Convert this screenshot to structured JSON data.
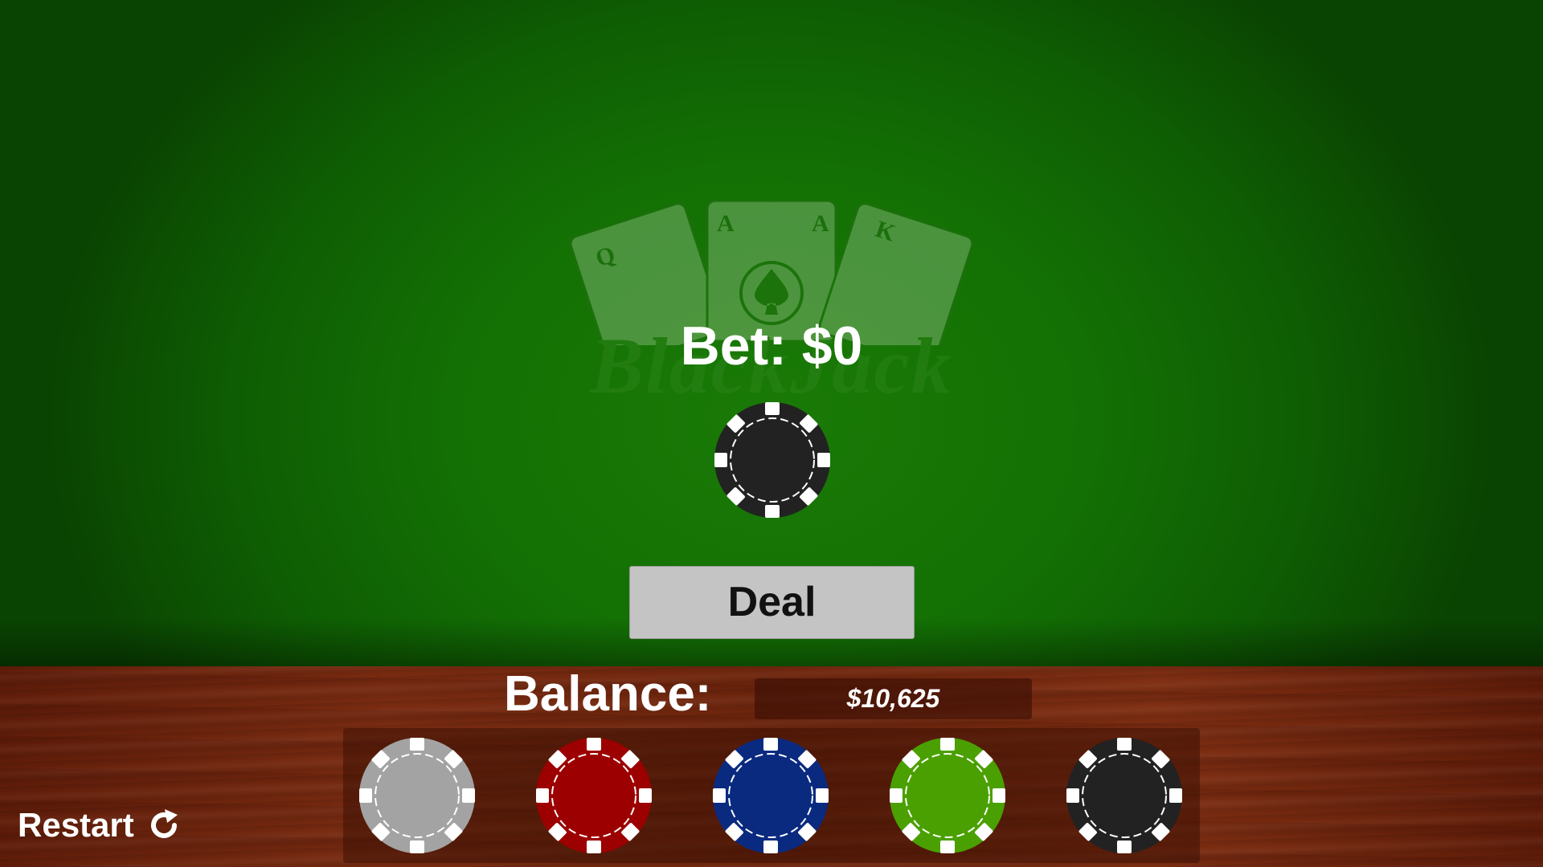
{
  "logo": {
    "title": "BlackJack",
    "cards": [
      "Q",
      "A",
      "K"
    ]
  },
  "bet": {
    "label": "Bet: $0",
    "chip_color": "#222222"
  },
  "deal": {
    "label": "Deal"
  },
  "balance": {
    "label": "Balance:",
    "value": "$10,625"
  },
  "chips": [
    {
      "name": "grey",
      "color": "#a3a3a3"
    },
    {
      "name": "red",
      "color": "#9c0000"
    },
    {
      "name": "blue",
      "color": "#0a2a80"
    },
    {
      "name": "green",
      "color": "#4aa000"
    },
    {
      "name": "black",
      "color": "#222222"
    }
  ],
  "restart": {
    "label": "Restart"
  }
}
